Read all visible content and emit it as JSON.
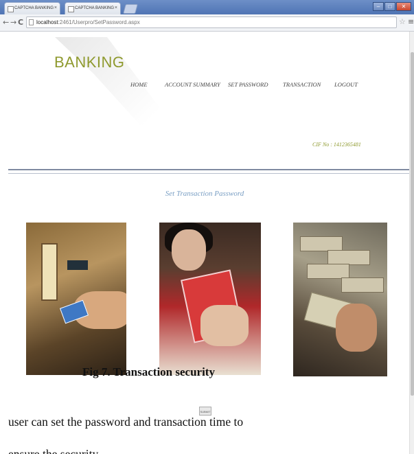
{
  "browser": {
    "tabs": [
      {
        "title": "CAPTCHA BANKING"
      },
      {
        "title": "CAPTCHA BANKING"
      }
    ],
    "address": {
      "host": "localhost",
      "path": ":2461/Userpro/SetPassword.aspx"
    },
    "window_buttons": {
      "minimize": "–",
      "maximize": "□",
      "close": "✕"
    },
    "icons": {
      "back": "←",
      "forward": "→",
      "reload": "C",
      "star": "☆",
      "menu": "≡"
    }
  },
  "page": {
    "brand": "BANKING",
    "nav": [
      "HOME",
      "ACCOUNT SUMMARY",
      "SET PASSWORD",
      "TRANSACTION",
      "LOGOUT"
    ],
    "cif": "CIF No : 1412365481",
    "section_title": "Set Transaction Password",
    "submit_label": "SUBMIT"
  },
  "document": {
    "caption": "Fig 7. Transaction security",
    "body_line1": "user can set the password and transaction time to",
    "body_line2": "ensure the security."
  },
  "colors": {
    "brand": "#8f9a2f",
    "section_title": "#7a9fc4",
    "titlebar": "#4f74b4"
  }
}
